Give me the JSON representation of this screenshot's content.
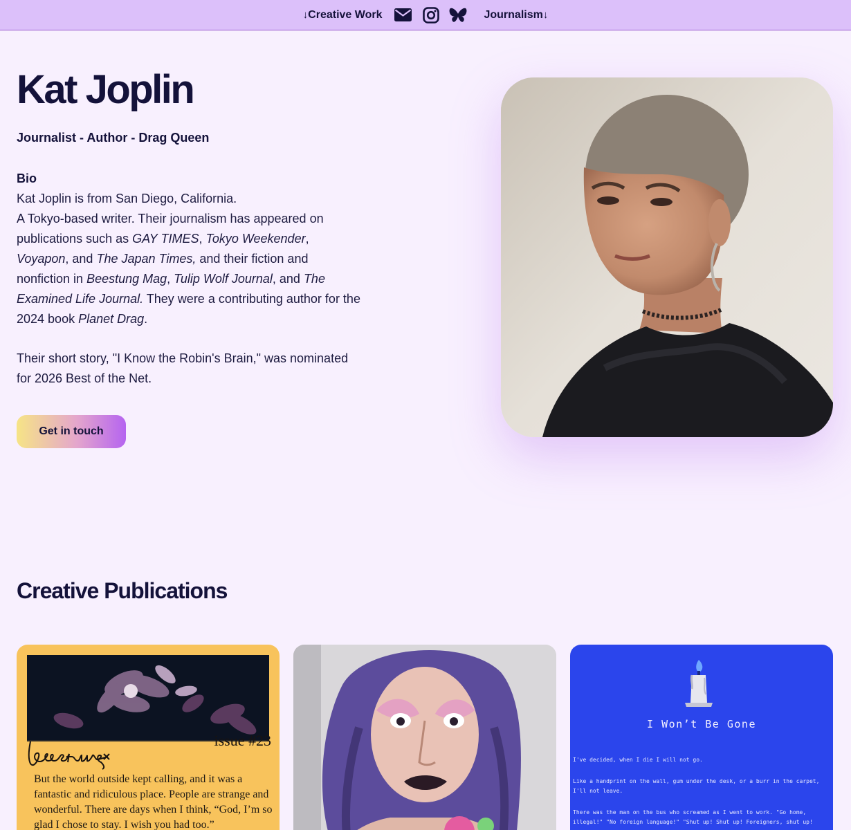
{
  "nav": {
    "creative_label": "Creative Work",
    "journalism_label": "Journalism",
    "down_arrow": "↓",
    "icons": [
      "envelope-icon",
      "instagram-icon",
      "bluesky-icon"
    ]
  },
  "hero": {
    "name": "Kat Joplin",
    "tagline": "Journalist - Author - Drag Queen",
    "bio_heading": "Bio",
    "bio_line1": "Kat Joplin is from San Diego, California.",
    "bio_p1": [
      {
        "t": "A Tokyo-based writer. Their journalism has appeared on publications such as "
      },
      {
        "t": "GAY TIMES",
        "i": true
      },
      {
        "t": ", "
      },
      {
        "t": "Tokyo Weekender",
        "i": true
      },
      {
        "t": ", "
      },
      {
        "t": "Voyapon",
        "i": true
      },
      {
        "t": ", and "
      },
      {
        "t": "The Japan Times,",
        "i": true
      },
      {
        "t": " and their fiction and nonfiction in "
      },
      {
        "t": "Beestung Mag",
        "i": true
      },
      {
        "t": ", "
      },
      {
        "t": "Tulip Wolf Journal",
        "i": true
      },
      {
        "t": ", and "
      },
      {
        "t": "The Examined Life Journal.",
        "i": true
      },
      {
        "t": " They were a contributing author for the 2024 book "
      },
      {
        "t": "Planet Drag",
        "i": true
      },
      {
        "t": "."
      }
    ],
    "bio_p2": "Their short story, \"I Know the Robin's Brain,\" was nominated for 2026 Best of the Net.",
    "cta_label": "Get in touch"
  },
  "creative": {
    "heading": "Creative Publications",
    "card1": {
      "issue": "issue #23",
      "signature": "beestung",
      "quote": "But the world outside kept calling, and it was a fantastic and ridiculous place. People are strange and wonderful. There are days when I think, “God, I’m so glad I chose to stay. I wish you had too.”"
    },
    "card3": {
      "title": "I Won’t Be Gone",
      "lines": [
        "I've decided, when I die I will not go.",
        "Like a handprint on the wall, gum under the desk, or a burr in the carpet, I'll not leave.",
        "There was the man on the bus who screamed as I went to work. \"Go home, illegal!\" \"No foreign language!\" \"Shut up! Shut up! Foreigners, shut up!"
      ]
    }
  },
  "colors": {
    "nav_bg": "#dcc0fa",
    "page_bg": "#f8f0fe",
    "text": "#14123a",
    "card1_bg": "#f8c35c",
    "card3_bg": "#2b45ec"
  }
}
